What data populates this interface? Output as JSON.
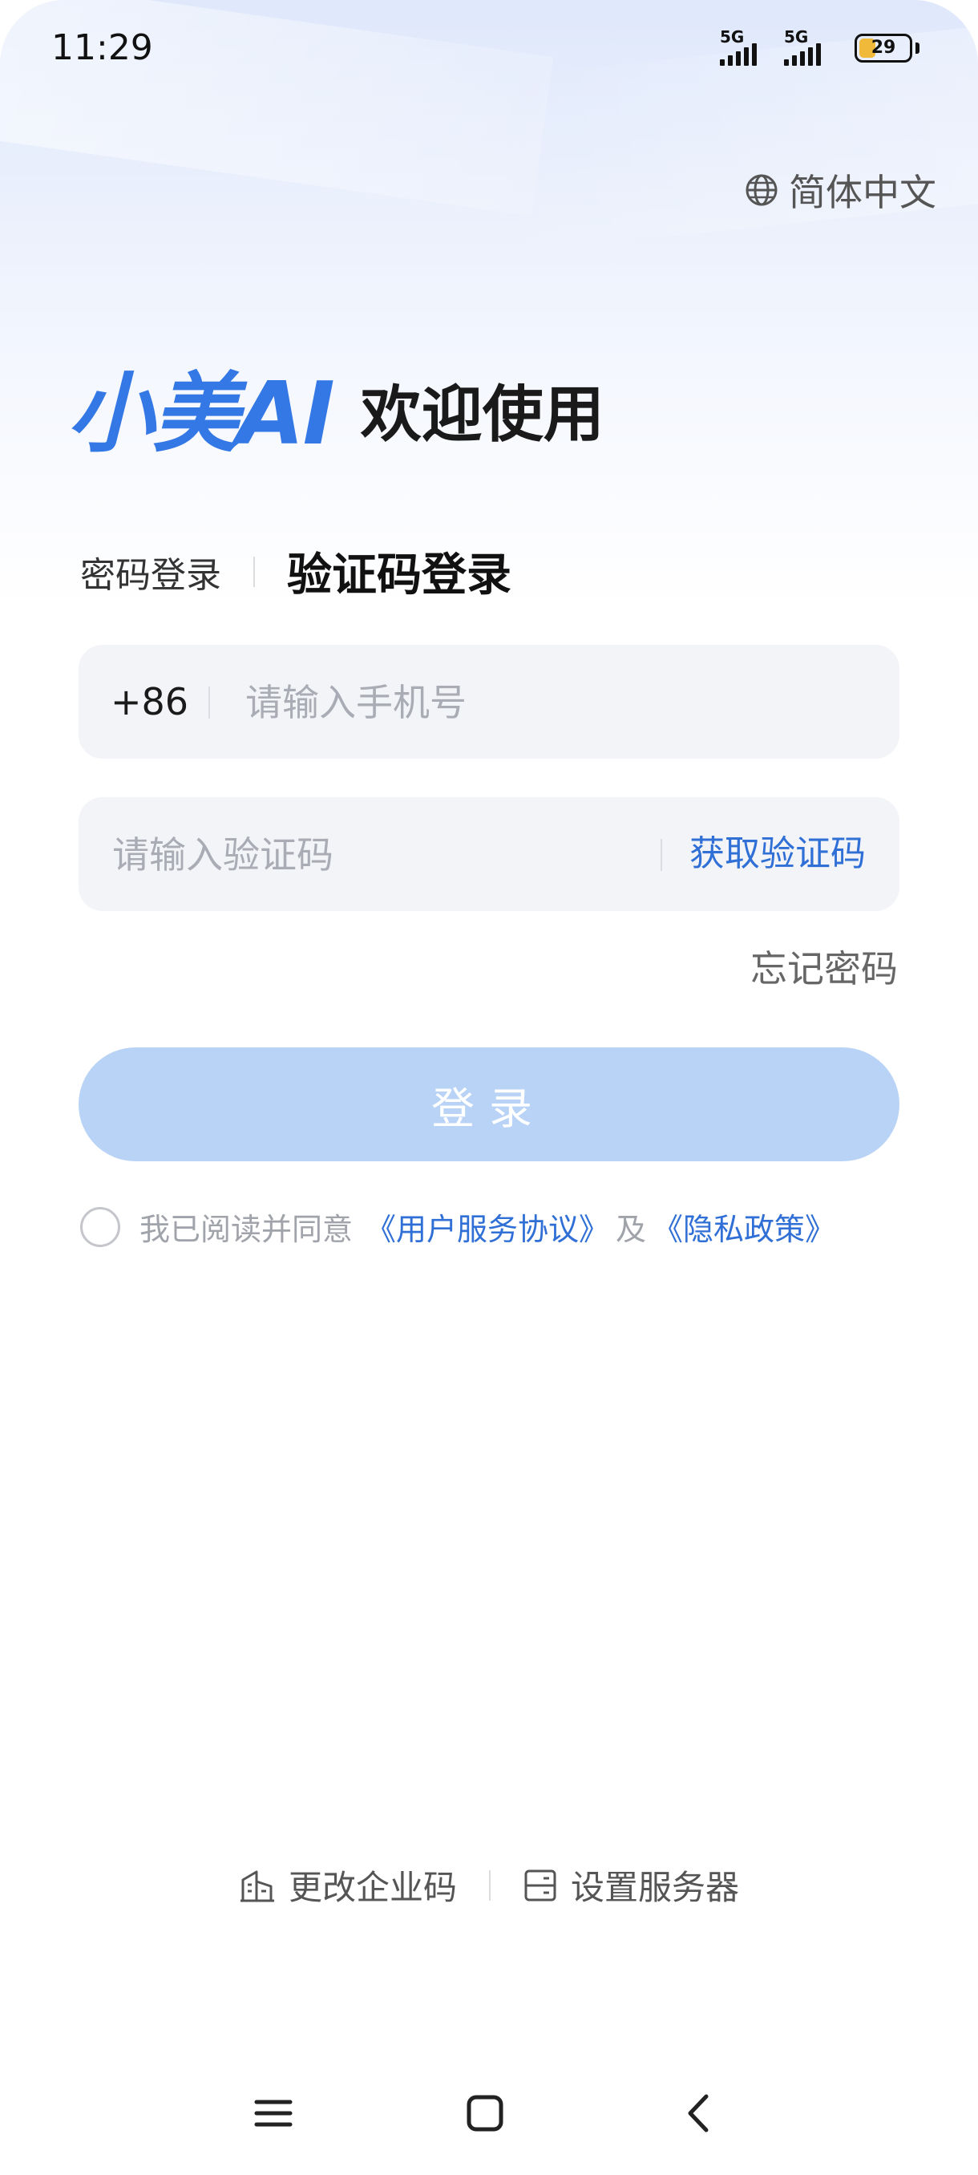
{
  "status_bar": {
    "time": "11:29",
    "network_1": "5G",
    "network_2": "5G",
    "battery": "29"
  },
  "language": {
    "icon": "globe-icon",
    "label": "简体中文"
  },
  "brand": {
    "logo": "小美AI",
    "welcome": "欢迎使用",
    "logo_color": "#3478e6"
  },
  "tabs": {
    "password_login": "密码登录",
    "code_login": "验证码登录"
  },
  "phone": {
    "prefix": "+86",
    "placeholder": "请输入手机号",
    "value": ""
  },
  "code": {
    "placeholder": "请输入验证码",
    "value": "",
    "get_code_label": "获取验证码"
  },
  "forgot_password": "忘记密码",
  "login_button": "登录",
  "agreement": {
    "checked": false,
    "prefix": "我已阅读并同意",
    "terms": "《用户服务协议》",
    "and": "及",
    "privacy": "《隐私政策》",
    "link_color": "#2f6fd6"
  },
  "bottom_links": {
    "enterprise": "更改企业码",
    "enterprise_icon": "building-icon",
    "server": "设置服务器",
    "server_icon": "server-icon"
  },
  "nav": {
    "menu_icon": "menu-icon",
    "home_icon": "home-square-icon",
    "back_icon": "back-chevron-icon"
  },
  "colors": {
    "accent": "#2f6fd6",
    "button_disabled": "#b9d3f6",
    "field_bg": "#f3f4f8"
  }
}
